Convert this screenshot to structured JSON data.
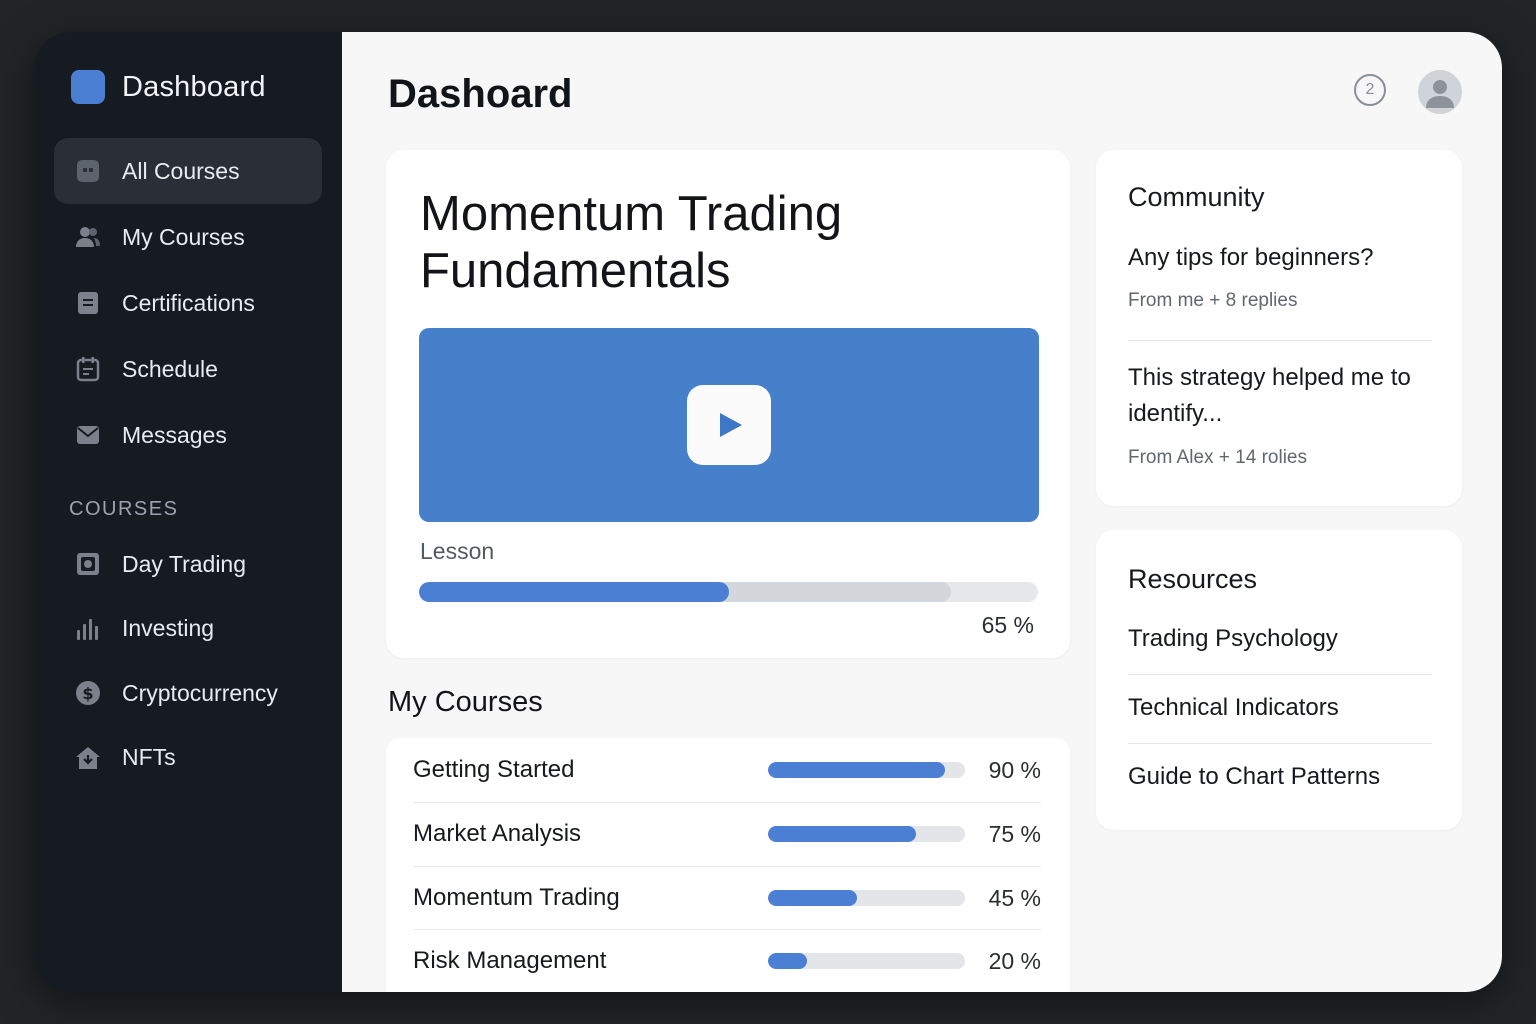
{
  "brand": {
    "title": "Dashboard",
    "logo_color": "#4a7fd4"
  },
  "nav": {
    "items": [
      {
        "label": "All Courses",
        "icon": "grid-icon",
        "active": true
      },
      {
        "label": "My Courses",
        "icon": "users-icon"
      },
      {
        "label": "Certifications",
        "icon": "document-icon"
      },
      {
        "label": "Schedule",
        "icon": "calendar-icon"
      },
      {
        "label": "Messages",
        "icon": "mail-icon"
      }
    ],
    "section_label": "COURSES",
    "course_items": [
      {
        "label": "Day Trading",
        "icon": "square-target-icon"
      },
      {
        "label": "Investing",
        "icon": "bar-chart-icon"
      },
      {
        "label": "Cryptocurrency",
        "icon": "dollar-coin-icon"
      },
      {
        "label": "NFTs",
        "icon": "house-download-icon"
      }
    ]
  },
  "header": {
    "title": "Dashoard",
    "help_badge": "2"
  },
  "hero": {
    "title": "Momentum Trading Fundamentals",
    "lesson_label": "Lesson",
    "progress": 0.5,
    "progress_label": "65 %",
    "video_color": "#4680cb"
  },
  "courses": {
    "heading": "My Courses",
    "rows": [
      {
        "name": "Getting Started",
        "progress": 0.9,
        "label": "90 %"
      },
      {
        "name": "Market Analysis",
        "progress": 0.75,
        "label": "75 %"
      },
      {
        "name": "Momentum Trading",
        "progress": 0.45,
        "label": "45 %"
      },
      {
        "name": "Risk Management",
        "progress": 0.2,
        "label": "20 %"
      }
    ]
  },
  "community": {
    "title": "Community",
    "threads": [
      {
        "title": "Any tips for beginners?",
        "meta": "From me + 8 replies"
      },
      {
        "title": "This strategy helped me to identify...",
        "meta": "From Alex + 14 rolies"
      }
    ]
  },
  "resources": {
    "title": "Resources",
    "items": [
      "Trading Psychology",
      "Technical Indicators",
      "Guide to Chart Patterns"
    ]
  },
  "colors": {
    "accent": "#4a7fd4",
    "sidebar_bg": "#161b22",
    "main_bg": "#f7f7f8"
  }
}
